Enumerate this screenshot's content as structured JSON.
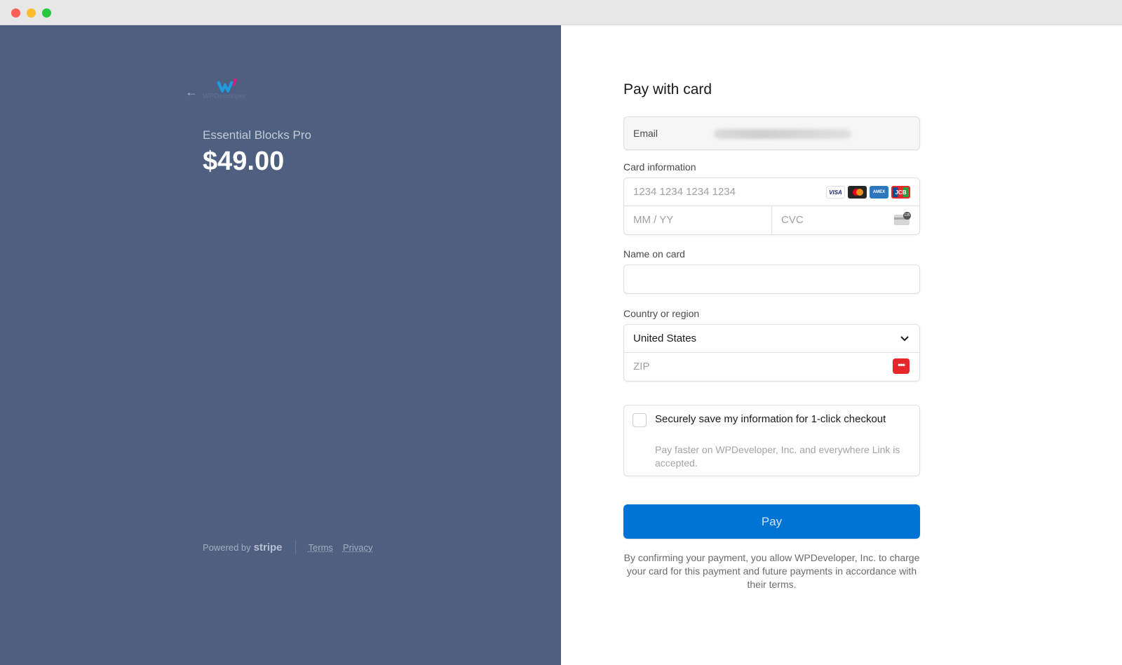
{
  "window": {
    "controls": [
      "close",
      "minimize",
      "maximize"
    ]
  },
  "merchant": {
    "logo_text": "WPDeveloper",
    "back_icon": "arrow-left-icon",
    "product_name": "Essential Blocks Pro",
    "price": "$49.00"
  },
  "footer": {
    "powered_by": "Powered by",
    "brand": "stripe",
    "terms": "Terms",
    "privacy": "Privacy"
  },
  "form": {
    "title": "Pay with card",
    "email": {
      "label": "Email",
      "value_redacted": true
    },
    "card": {
      "label": "Card information",
      "number_placeholder": "1234 1234 1234 1234",
      "expiry_placeholder": "MM / YY",
      "cvc_placeholder": "CVC",
      "brands": [
        "VISA",
        "Mastercard",
        "AMEX",
        "JCB"
      ]
    },
    "name": {
      "label": "Name on card",
      "value": ""
    },
    "country": {
      "label": "Country or region",
      "selected": "United States",
      "zip_placeholder": "ZIP"
    },
    "save": {
      "title": "Securely save my information for 1-click checkout",
      "description": "Pay faster on WPDeveloper, Inc. and everywhere Link is accepted.",
      "checked": false
    },
    "pay_label": "Pay",
    "terms_text": "By confirming your payment, you allow WPDeveloper, Inc. to charge your card for this payment and future payments in accordance with their terms."
  },
  "colors": {
    "left_panel": "#4f5f80",
    "pay_button": "#0074d4"
  }
}
